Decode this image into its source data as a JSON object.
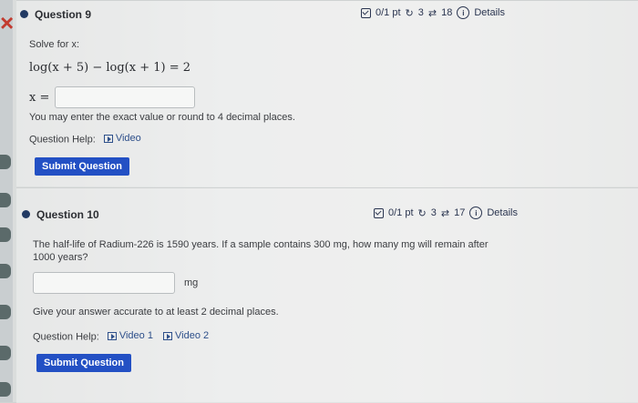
{
  "q1": {
    "title": "Question 9",
    "score": "0/1 pt",
    "retries": "3",
    "attempts": "18",
    "details": "Details",
    "prompt": "Solve for x:",
    "equation": "log(x + 5) − log(x + 1) = 2",
    "var_label": "x =",
    "hint": "You may enter the exact value or round to 4 decimal places.",
    "help_label": "Question Help:",
    "help_links": [
      "Video"
    ],
    "submit": "Submit Question"
  },
  "q2": {
    "title": "Question 10",
    "score": "0/1 pt",
    "retries": "3",
    "attempts": "17",
    "details": "Details",
    "prompt_line1": "The half-life of Radium-226 is 1590 years. If a sample contains 300 mg, how many mg will remain after",
    "prompt_line2": "1000 years?",
    "unit": "mg",
    "hint": "Give your answer accurate to at least 2 decimal places.",
    "help_label": "Question Help:",
    "help_links": [
      "Video 1",
      "Video 2"
    ],
    "submit": "Submit Question"
  },
  "colors": {
    "accent": "#2350c4",
    "close": "#c23b2f",
    "bullet": "#223a63"
  },
  "icons": [
    "close-icon",
    "checkbox-icon",
    "retry-icon",
    "attempts-icon",
    "info-icon",
    "video-play-icon"
  ]
}
